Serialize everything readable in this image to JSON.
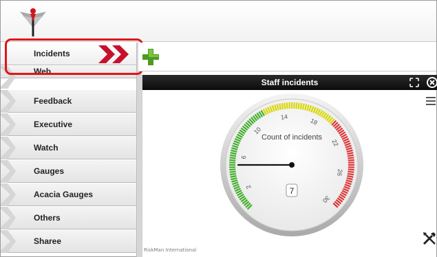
{
  "app": {
    "footer_credit": "RiskMan International"
  },
  "sidebar": {
    "items": [
      {
        "label": "Incidents",
        "active": true
      },
      {
        "label": "Web"
      },
      {
        "label": "Feedback"
      },
      {
        "label": "Executive"
      },
      {
        "label": "Watch"
      },
      {
        "label": "Gauges"
      },
      {
        "label": "Acacia Gauges"
      },
      {
        "label": "Others"
      },
      {
        "label": "Sharee"
      }
    ]
  },
  "toolbar": {
    "add_icon": "plus-icon"
  },
  "widget": {
    "title": "Staff incidents",
    "icons": [
      "expand-icon",
      "close-icon",
      "hamburger-menu-icon",
      "tools-icon"
    ],
    "gauge": {
      "label": "Count of incidents",
      "value": 7,
      "min": 0,
      "max": 30,
      "tick_labels": [
        "2",
        "6",
        "10",
        "14",
        "18",
        "22",
        "26",
        "30"
      ],
      "bands": [
        {
          "from": 0,
          "to": 12,
          "color": "#3fae2a"
        },
        {
          "from": 12,
          "to": 20,
          "color": "#d9d600"
        },
        {
          "from": 20,
          "to": 30,
          "color": "#dd3333"
        }
      ],
      "needle_value": 5
    }
  },
  "colors": {
    "highlight": "#e0141b",
    "active_chevron": "#c8102e",
    "header_bg": "#111111"
  }
}
